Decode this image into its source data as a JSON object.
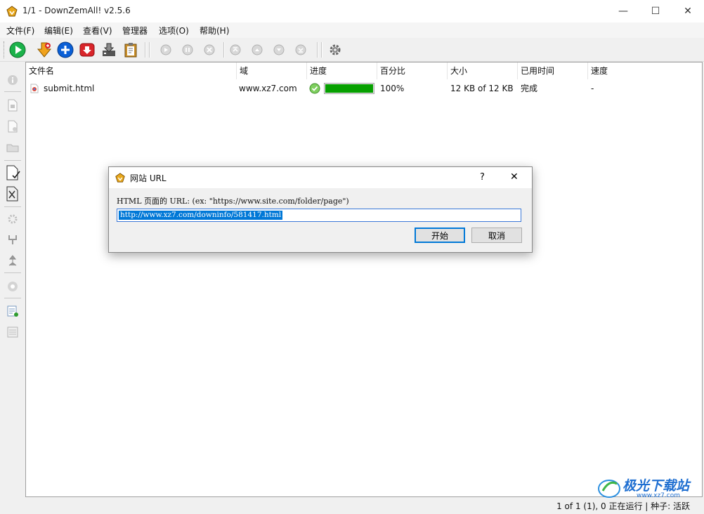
{
  "window": {
    "title": "1/1 - DownZemAll! v2.5.6",
    "minimize_glyph": "—",
    "maximize_glyph": "☐",
    "close_glyph": "✕"
  },
  "menu": [
    "文件(F)",
    "编辑(E)",
    "查看(V)",
    "管理器",
    "选项(O)",
    "帮助(H)"
  ],
  "toolbar": {
    "icons": [
      "start-all-icon",
      "add-download-icon",
      "add-url-icon",
      "stop-icon",
      "download-manager-icon",
      "paste-icon",
      "resume-icon",
      "pause-icon",
      "cancel-icon",
      "move-top-icon",
      "move-up-icon",
      "move-down-icon",
      "move-bottom-icon",
      "settings-icon"
    ]
  },
  "list": {
    "columns": [
      "文件名",
      "域",
      "进度",
      "百分比",
      "大小",
      "已用时间",
      "速度"
    ],
    "rows": [
      {
        "filename": "submit.html",
        "domain": "www.xz7.com",
        "progress": 1.0,
        "percent": "100%",
        "size": "12 KB of 12 KB",
        "elapsed": "完成",
        "speed": "-"
      }
    ]
  },
  "dialog": {
    "title": "网站 URL",
    "help_glyph": "?",
    "close_glyph": "✕",
    "label": "HTML 页面的 URL:   (ex: \"https://www.site.com/folder/page\")",
    "url_value": "http://www.xz7.com/downinfo/581417.html",
    "start_button": "开始",
    "cancel_button": "取消"
  },
  "status": {
    "text": "1 of 1 (1), 0 正在运行 | 种子: 活跃"
  },
  "watermark": {
    "text": "极光下载站",
    "url": "www.xz7.com"
  },
  "colors": {
    "progress_fill": "#06a000",
    "selection": "#0078d7",
    "accent_blue": "#0a5fd6",
    "stop_red": "#d9252a",
    "start_green": "#1bb24a"
  }
}
